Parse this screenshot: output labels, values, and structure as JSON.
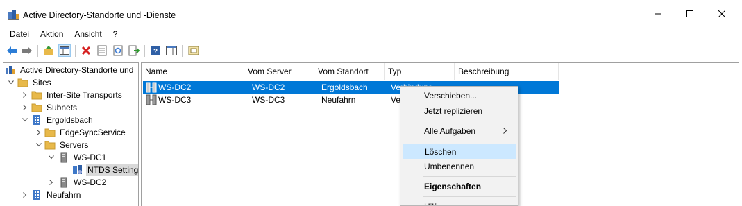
{
  "window": {
    "title": "Active Directory-Standorte und -Dienste"
  },
  "menu": [
    "Datei",
    "Aktion",
    "Ansicht",
    "?"
  ],
  "tree": {
    "root": "Active Directory-Standorte und",
    "sites": "Sites",
    "inter_site": "Inter-Site Transports",
    "subnets": "Subnets",
    "ergoldsbach": "Ergoldsbach",
    "edgesync": "EdgeSyncService",
    "servers": "Servers",
    "ws_dc1": "WS-DC1",
    "ntds": "NTDS Settings",
    "ws_dc2": "WS-DC2",
    "neufahrn": "Neufahrn"
  },
  "list": {
    "columns": [
      "Name",
      "Vom Server",
      "Vom Standort",
      "Typ",
      "Beschreibung"
    ],
    "rows": [
      {
        "name": "WS-DC2",
        "server": "WS-DC2",
        "site": "Ergoldsbach",
        "type": "Verbindung"
      },
      {
        "name": "WS-DC3",
        "server": "WS-DC3",
        "site": "Neufahrn",
        "type": "Ver"
      }
    ]
  },
  "context_menu": {
    "move": "Verschieben...",
    "replicate": "Jetzt replizieren",
    "all_tasks": "Alle Aufgaben",
    "delete": "Löschen",
    "rename": "Umbenennen",
    "properties": "Eigenschaften",
    "help": "Hilfe"
  },
  "colors": {
    "selection": "#0078d7",
    "menu_highlight": "#cce8ff",
    "folder": "#e8b94a"
  }
}
